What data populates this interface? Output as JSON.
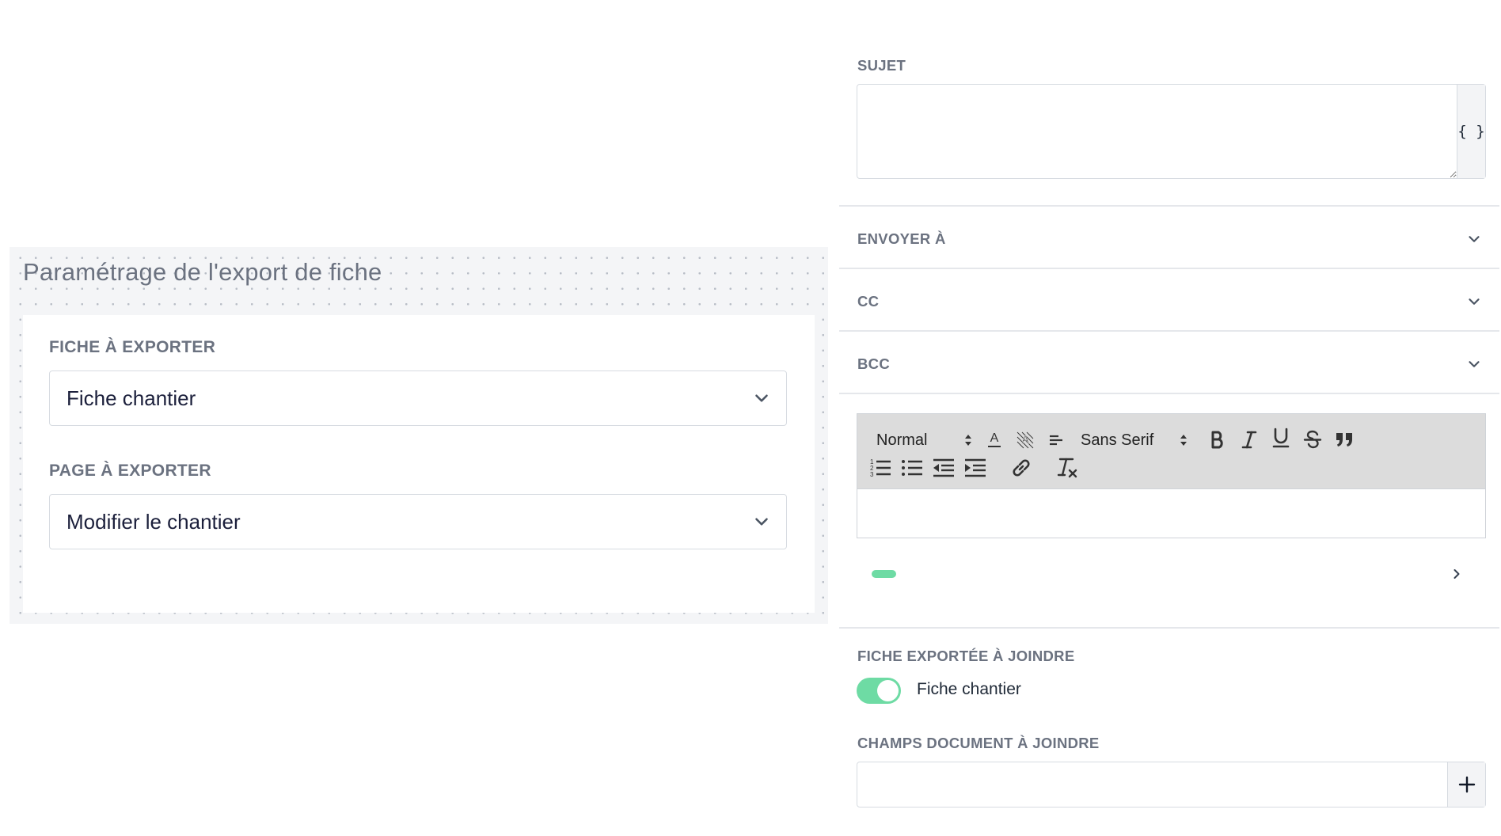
{
  "export_settings": {
    "title": "Paramétrage de l'export de fiche",
    "fiche_label": "FICHE À EXPORTER",
    "fiche_value": "Fiche chantier",
    "page_label": "PAGE À EXPORTER",
    "page_value": "Modifier le chantier"
  },
  "email": {
    "subject_label": "SUJET",
    "subject_value": "",
    "variables_button": "{ }",
    "recipients": [
      {
        "label": "ENVOYER À"
      },
      {
        "label": "CC"
      },
      {
        "label": "BCC"
      }
    ],
    "editor": {
      "header_select": "Normal",
      "font_select": "Sans Serif",
      "body": ""
    },
    "attached_form_label": "FICHE EXPORTÉE À JOINDRE",
    "attached_form_toggle": {
      "on": true,
      "label": "Fiche chantier"
    },
    "document_fields_label": "CHAMPS DOCUMENT À JOINDRE",
    "document_fields_value": ""
  },
  "colors": {
    "accent_green": "#6edba4",
    "label_gray": "#6b7280",
    "toolbar_bg": "#dcdcdc",
    "dotted_bg": "#f4f5f7"
  },
  "icons": {
    "dropdown": "chevron-down-icon",
    "expand_right": "chevron-right-icon",
    "add": "plus-icon",
    "variables": "braces-icon"
  }
}
